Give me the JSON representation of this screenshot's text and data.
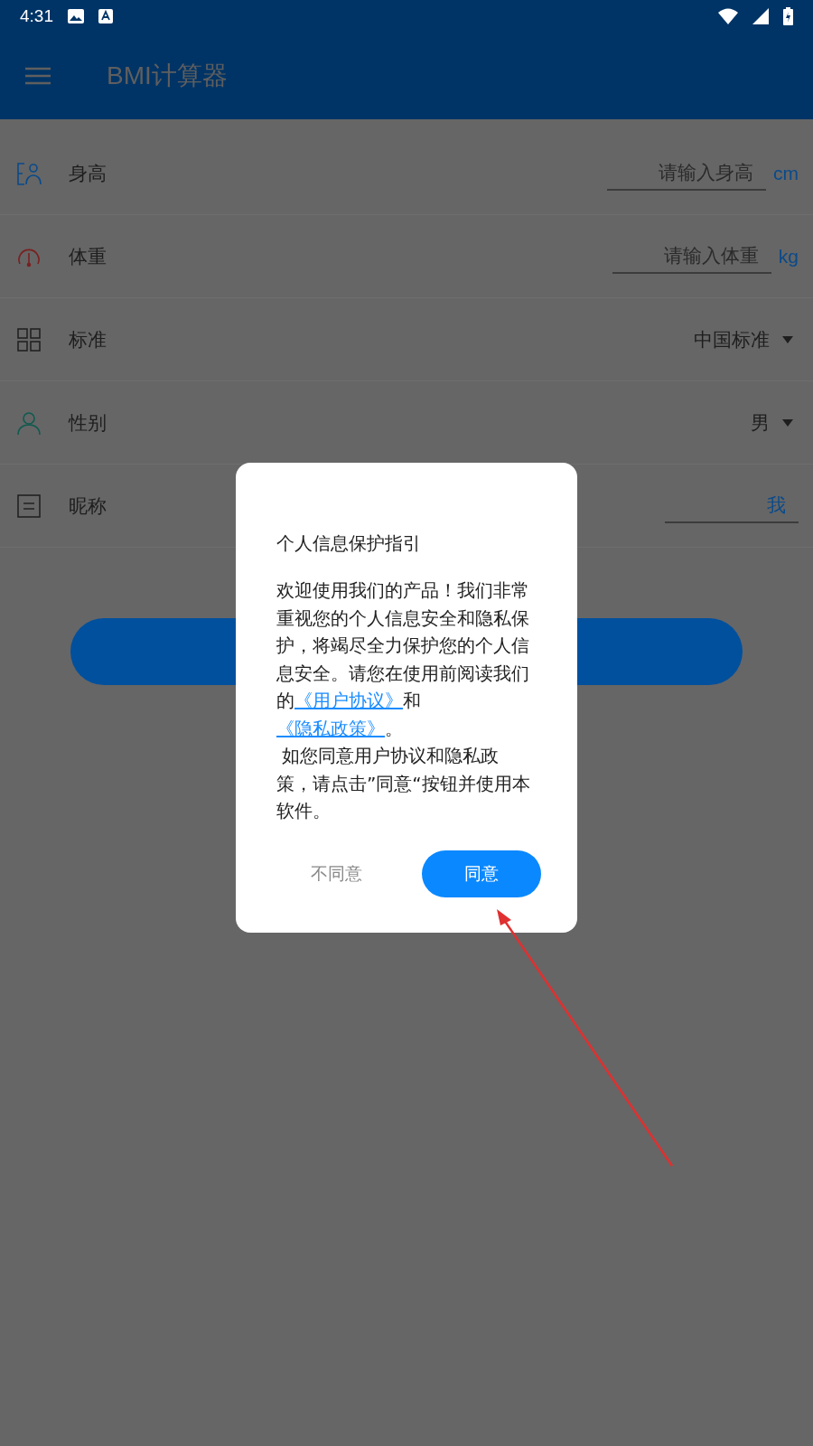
{
  "status_bar": {
    "time": "4:31"
  },
  "app_bar": {
    "title": "BMI计算器"
  },
  "form": {
    "rows": [
      {
        "kind": "input",
        "label": "身高",
        "placeholder": "请输入身高",
        "unit": "cm"
      },
      {
        "kind": "input",
        "label": "体重",
        "placeholder": "请输入体重",
        "unit": "kg"
      },
      {
        "kind": "select",
        "label": "标准",
        "value": "中国标准"
      },
      {
        "kind": "select",
        "label": "性别",
        "value": "男"
      },
      {
        "kind": "input",
        "label": "昵称",
        "value": "我"
      }
    ]
  },
  "dialog": {
    "title": "个人信息保护指引",
    "body": [
      {
        "kind": "text",
        "text": "欢迎使用我们的产品！我们非常重视您的个人信息安全和隐私保护，将竭尽全力保护您的个人信息安全。请您在使用前阅读我们的"
      },
      {
        "kind": "link",
        "text": "《用户协议》"
      },
      {
        "kind": "text",
        "text": "和"
      },
      {
        "kind": "link",
        "text": "《隐私政策》"
      },
      {
        "kind": "text",
        "text": "。"
      }
    ],
    "note": " 如您同意用户协议和隐私政策，请点击”同意“按钮并使用本软件。",
    "buttons": [
      {
        "kind": "text",
        "label": "不同意"
      },
      {
        "kind": "filled",
        "label": "同意"
      }
    ]
  }
}
